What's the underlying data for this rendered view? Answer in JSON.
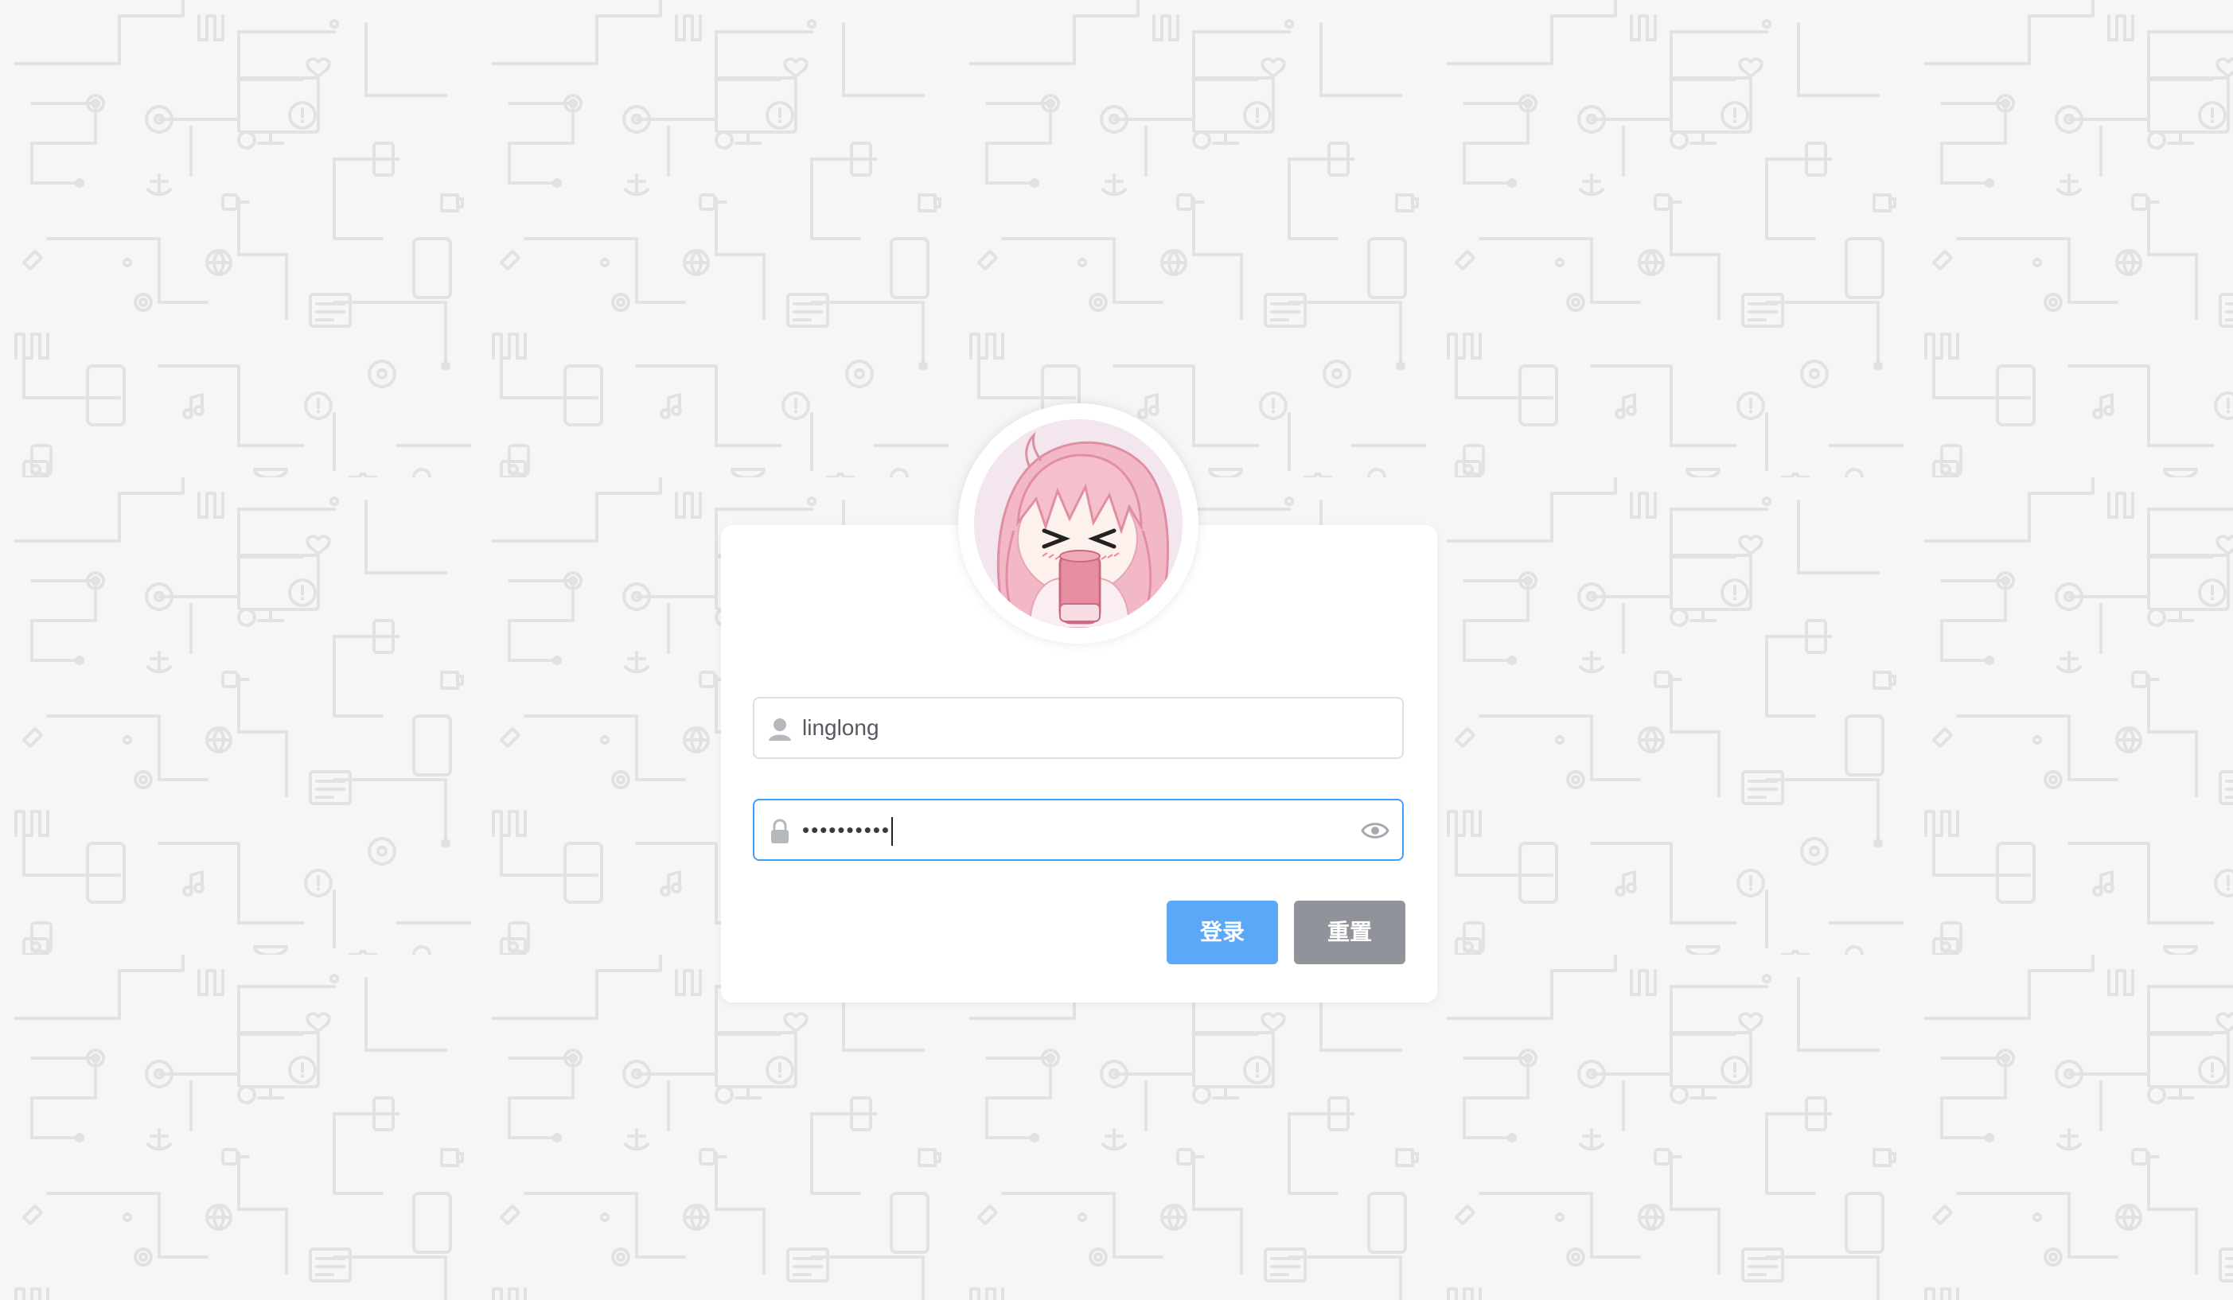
{
  "login_form": {
    "username": {
      "value": "linglong",
      "icon": "user-icon"
    },
    "password": {
      "masked_value": "••••••••••",
      "icon": "lock-icon",
      "toggle_icon": "eye-icon"
    },
    "buttons": {
      "login_label": "登录",
      "reset_label": "重置"
    }
  },
  "avatar": {
    "description_icon": "avatar-image"
  },
  "colors": {
    "background": "#f6f6f6",
    "pattern": "#e3e3e3",
    "card": "#ffffff",
    "focus_border": "#409eff",
    "login_button": "#5ca8f8",
    "reset_button": "#909399"
  }
}
